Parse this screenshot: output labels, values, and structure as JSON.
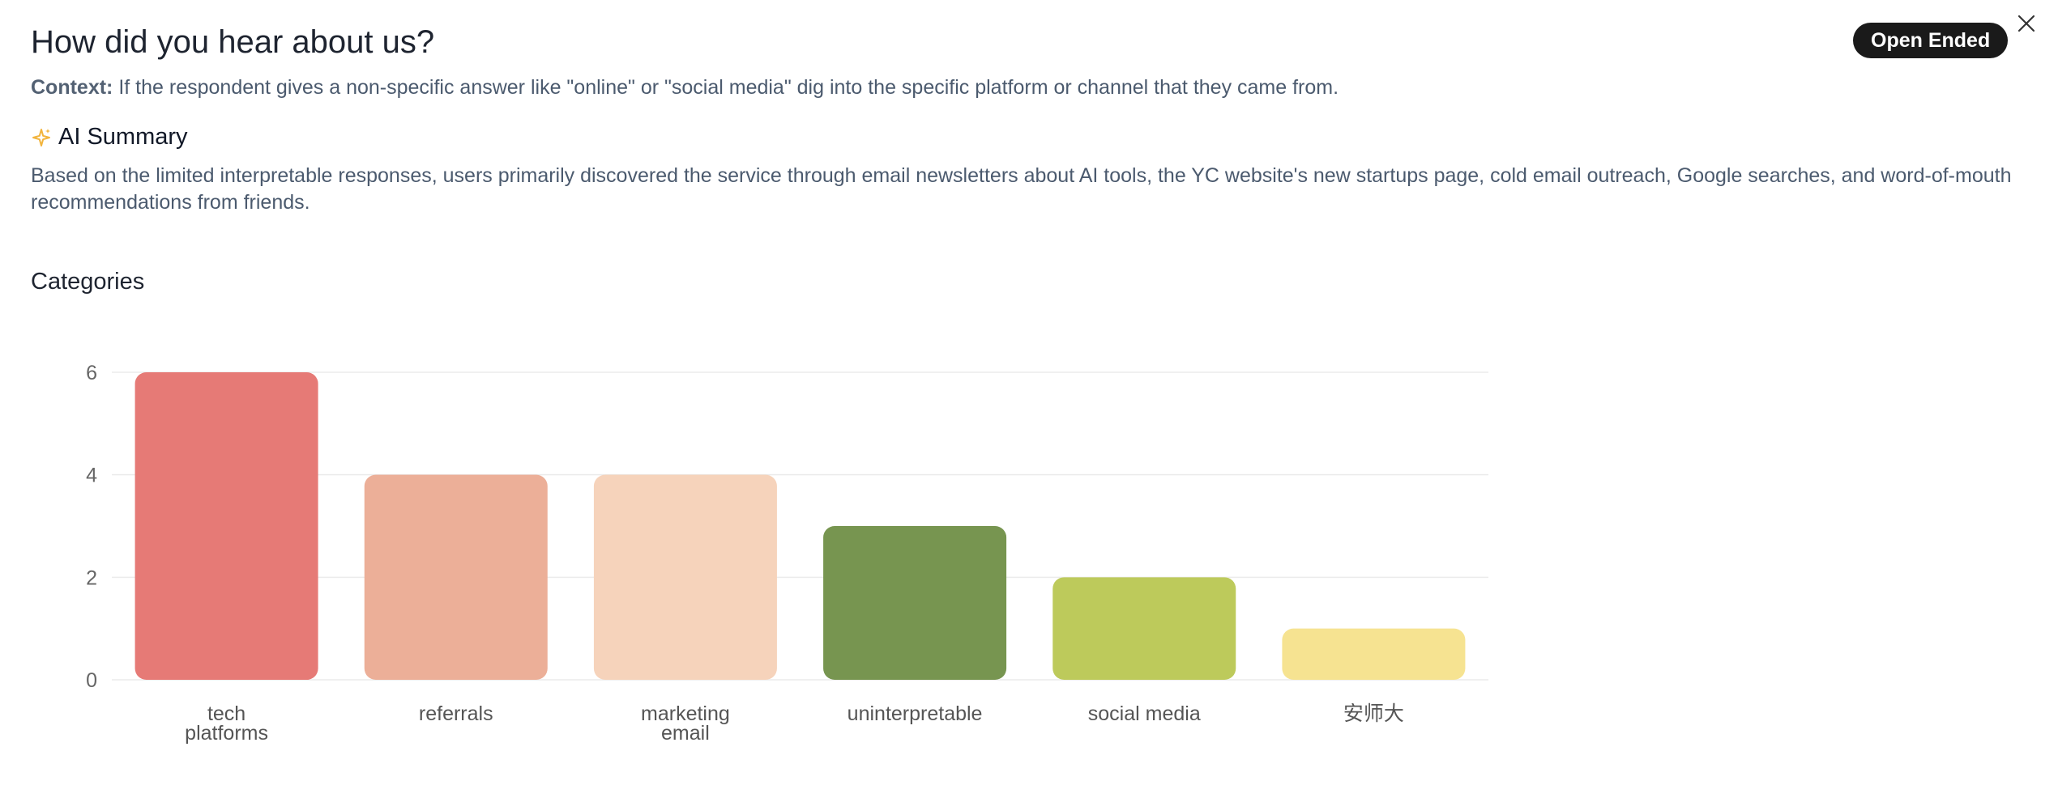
{
  "header": {
    "title": "How did you hear about us?",
    "badge": "Open Ended",
    "close_icon": "close-icon"
  },
  "context": {
    "label": "Context:",
    "text": " If the respondent gives a non-specific answer like \"online\" or \"social media\" dig into the specific platform or channel that they came from."
  },
  "ai_summary": {
    "icon": "sparkle-icon",
    "icon_color": "#f2b43c",
    "title": "AI Summary",
    "text": "Based on the limited interpretable responses, users primarily discovered the service through email newsletters about AI tools, the YC website's new startups page, cold email outreach, Google searches, and word-of-mouth recommendations from friends."
  },
  "categories_section": {
    "title": "Categories"
  },
  "chart_data": {
    "type": "bar",
    "categories": [
      "tech platforms",
      "referrals",
      "marketing email",
      "uninterpretable",
      "social media",
      "安师大"
    ],
    "category_lines": [
      [
        "tech",
        "platforms"
      ],
      [
        "referrals"
      ],
      [
        "marketing",
        "email"
      ],
      [
        "uninterpretable"
      ],
      [
        "social media"
      ],
      [
        "安师大"
      ]
    ],
    "values": [
      6,
      4,
      4,
      3,
      2,
      1
    ],
    "colors": [
      "#e67a76",
      "#ecaf98",
      "#f6d3bb",
      "#779550",
      "#bdca5b",
      "#f6e391"
    ],
    "title": "",
    "xlabel": "",
    "ylabel": "",
    "ylim": [
      0,
      6
    ],
    "yticks": [
      0,
      2,
      4,
      6
    ],
    "grid": true
  }
}
